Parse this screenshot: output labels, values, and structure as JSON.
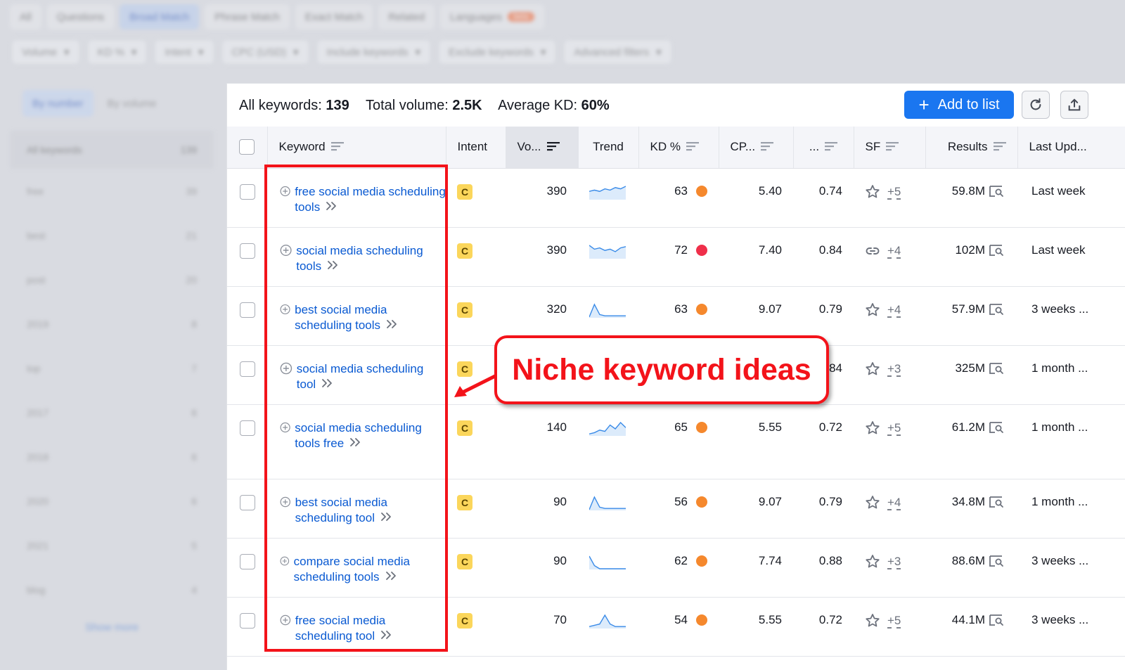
{
  "background": {
    "tabs": [
      {
        "label": "All",
        "selected": false
      },
      {
        "label": "Questions",
        "selected": false
      },
      {
        "label": "Broad Match",
        "selected": true
      },
      {
        "label": "Phrase Match",
        "selected": false
      },
      {
        "label": "Exact Match",
        "selected": false
      },
      {
        "label": "Related",
        "selected": false
      },
      {
        "label": "Languages",
        "selected": false,
        "badge": "beta"
      }
    ],
    "filters": [
      "Volume",
      "KD %",
      "Intent",
      "CPC (USD)",
      "Include keywords",
      "Exclude keywords",
      "Advanced filters"
    ],
    "sidebar": {
      "segments": [
        "By number",
        "By volume"
      ],
      "header": {
        "label": "All keywords",
        "count": "139"
      },
      "rows": [
        {
          "label": "free",
          "count": "39"
        },
        {
          "label": "best",
          "count": "21"
        },
        {
          "label": "post",
          "count": "20"
        },
        {
          "label": "2019",
          "count": "8"
        },
        {
          "label": "top",
          "count": "7"
        },
        {
          "label": "2017",
          "count": "6"
        },
        {
          "label": "2018",
          "count": "6"
        },
        {
          "label": "2020",
          "count": "6"
        },
        {
          "label": "2021",
          "count": "5"
        },
        {
          "label": "blog",
          "count": "4"
        }
      ],
      "show_more": "Show more"
    }
  },
  "summary": {
    "all_keywords_label": "All keywords:",
    "all_keywords_value": "139",
    "total_volume_label": "Total volume:",
    "total_volume_value": "2.5K",
    "avg_kd_label": "Average KD:",
    "avg_kd_value": "60%"
  },
  "toolbar": {
    "add_to_list": "Add to list"
  },
  "columns": [
    "Keyword",
    "Intent",
    "Vo...",
    "Trend",
    "KD %",
    "CP...",
    "...",
    "SF",
    "Results",
    "Last Upd..."
  ],
  "rows": [
    {
      "keyword": "free social media scheduling tools",
      "intent": "C",
      "volume": "390",
      "trend": [
        6,
        7,
        6,
        8,
        7,
        9,
        8,
        10
      ],
      "kd": "63",
      "kd_color": "#f5882d",
      "cpc": "5.40",
      "com": "0.74",
      "sf_icon": "star",
      "sf_more": "+5",
      "results": "59.8M",
      "last": "Last week"
    },
    {
      "keyword": "social media scheduling tools",
      "intent": "C",
      "volume": "390",
      "trend": [
        10,
        7,
        8,
        6,
        7,
        5,
        8,
        9
      ],
      "kd": "72",
      "kd_color": "#ef2f4a",
      "cpc": "7.40",
      "com": "0.84",
      "sf_icon": "link",
      "sf_more": "+4",
      "results": "102M",
      "last": "Last week"
    },
    {
      "keyword": "best social media scheduling tools",
      "intent": "C",
      "volume": "320",
      "trend": [
        0,
        10,
        2,
        1,
        1,
        1,
        1,
        1
      ],
      "kd": "63",
      "kd_color": "#f5882d",
      "cpc": "9.07",
      "com": "0.79",
      "sf_icon": "star",
      "sf_more": "+4",
      "results": "57.9M",
      "last": "3 weeks ..."
    },
    {
      "keyword": "social media scheduling tool",
      "intent": "C",
      "volume": "",
      "trend": [],
      "kd": "",
      "kd_color": "#f5882d",
      "cpc": "",
      "com": "0.84",
      "sf_icon": "star",
      "sf_more": "+3",
      "results": "325M",
      "last": "1 month ..."
    },
    {
      "keyword": "social media scheduling tools free",
      "intent": "C",
      "volume": "140",
      "trend": [
        1,
        2,
        4,
        3,
        8,
        5,
        10,
        6
      ],
      "kd": "65",
      "kd_color": "#f5882d",
      "cpc": "5.55",
      "com": "0.72",
      "sf_icon": "star",
      "sf_more": "+5",
      "results": "61.2M",
      "last": "1 month ..."
    },
    {
      "keyword": "best social media scheduling tool",
      "intent": "C",
      "volume": "90",
      "trend": [
        0,
        10,
        2,
        1,
        1,
        1,
        1,
        1
      ],
      "kd": "56",
      "kd_color": "#f5882d",
      "cpc": "9.07",
      "com": "0.79",
      "sf_icon": "star",
      "sf_more": "+4",
      "results": "34.8M",
      "last": "1 month ..."
    },
    {
      "keyword": "compare social media scheduling tools",
      "intent": "C",
      "volume": "90",
      "trend": [
        4,
        1,
        0,
        0,
        0,
        0,
        0,
        0
      ],
      "kd": "62",
      "kd_color": "#f5882d",
      "cpc": "7.74",
      "com": "0.88",
      "sf_icon": "star",
      "sf_more": "+3",
      "results": "88.6M",
      "last": "3 weeks ..."
    },
    {
      "keyword": "free social media scheduling tool",
      "intent": "C",
      "volume": "70",
      "trend": [
        1,
        2,
        3,
        10,
        3,
        1,
        1,
        1
      ],
      "kd": "54",
      "kd_color": "#f5882d",
      "cpc": "5.55",
      "com": "0.72",
      "sf_icon": "star",
      "sf_more": "+5",
      "results": "44.1M",
      "last": "3 weeks ..."
    }
  ],
  "annotation": {
    "callout": "Niche keyword ideas",
    "color": "#f3131a"
  },
  "colors": {
    "accent": "#1a76f0",
    "link": "#0a5ad2",
    "intent_commercial": "#fbd65b",
    "kd_hard": "#f5882d",
    "kd_very_hard": "#ef2f4a"
  }
}
